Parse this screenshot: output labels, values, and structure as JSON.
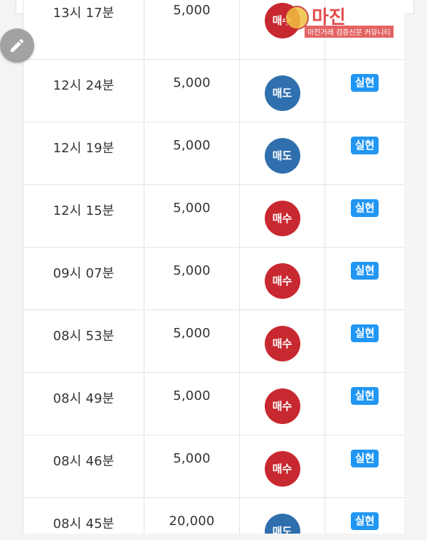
{
  "watermark": {
    "title": "마진",
    "subtitle": "마진거래 검증신문 커뮤니티"
  },
  "trades": [
    {
      "time": "13시 17분",
      "qty": "5,000",
      "side": "매수",
      "side_color": "#c8282f",
      "status": ""
    },
    {
      "time": "12시 24분",
      "qty": "5,000",
      "side": "매도",
      "side_color": "#2f6fae",
      "status": "실현"
    },
    {
      "time": "12시 19분",
      "qty": "5,000",
      "side": "매도",
      "side_color": "#2f6fae",
      "status": "실현"
    },
    {
      "time": "12시 15분",
      "qty": "5,000",
      "side": "매수",
      "side_color": "#c8282f",
      "status": "실현"
    },
    {
      "time": "09시 07분",
      "qty": "5,000",
      "side": "매수",
      "side_color": "#c8282f",
      "status": "실현"
    },
    {
      "time": "08시 53분",
      "qty": "5,000",
      "side": "매수",
      "side_color": "#c8282f",
      "status": "실현"
    },
    {
      "time": "08시 49분",
      "qty": "5,000",
      "side": "매수",
      "side_color": "#c8282f",
      "status": "실현"
    },
    {
      "time": "08시 46분",
      "qty": "5,000",
      "side": "매수",
      "side_color": "#c8282f",
      "status": "실현"
    },
    {
      "time": "08시 45분",
      "qty": "20,000",
      "side": "매도",
      "side_color": "#2f6fae",
      "status": "실현"
    }
  ],
  "icons": {
    "fab": "pencil-icon"
  }
}
